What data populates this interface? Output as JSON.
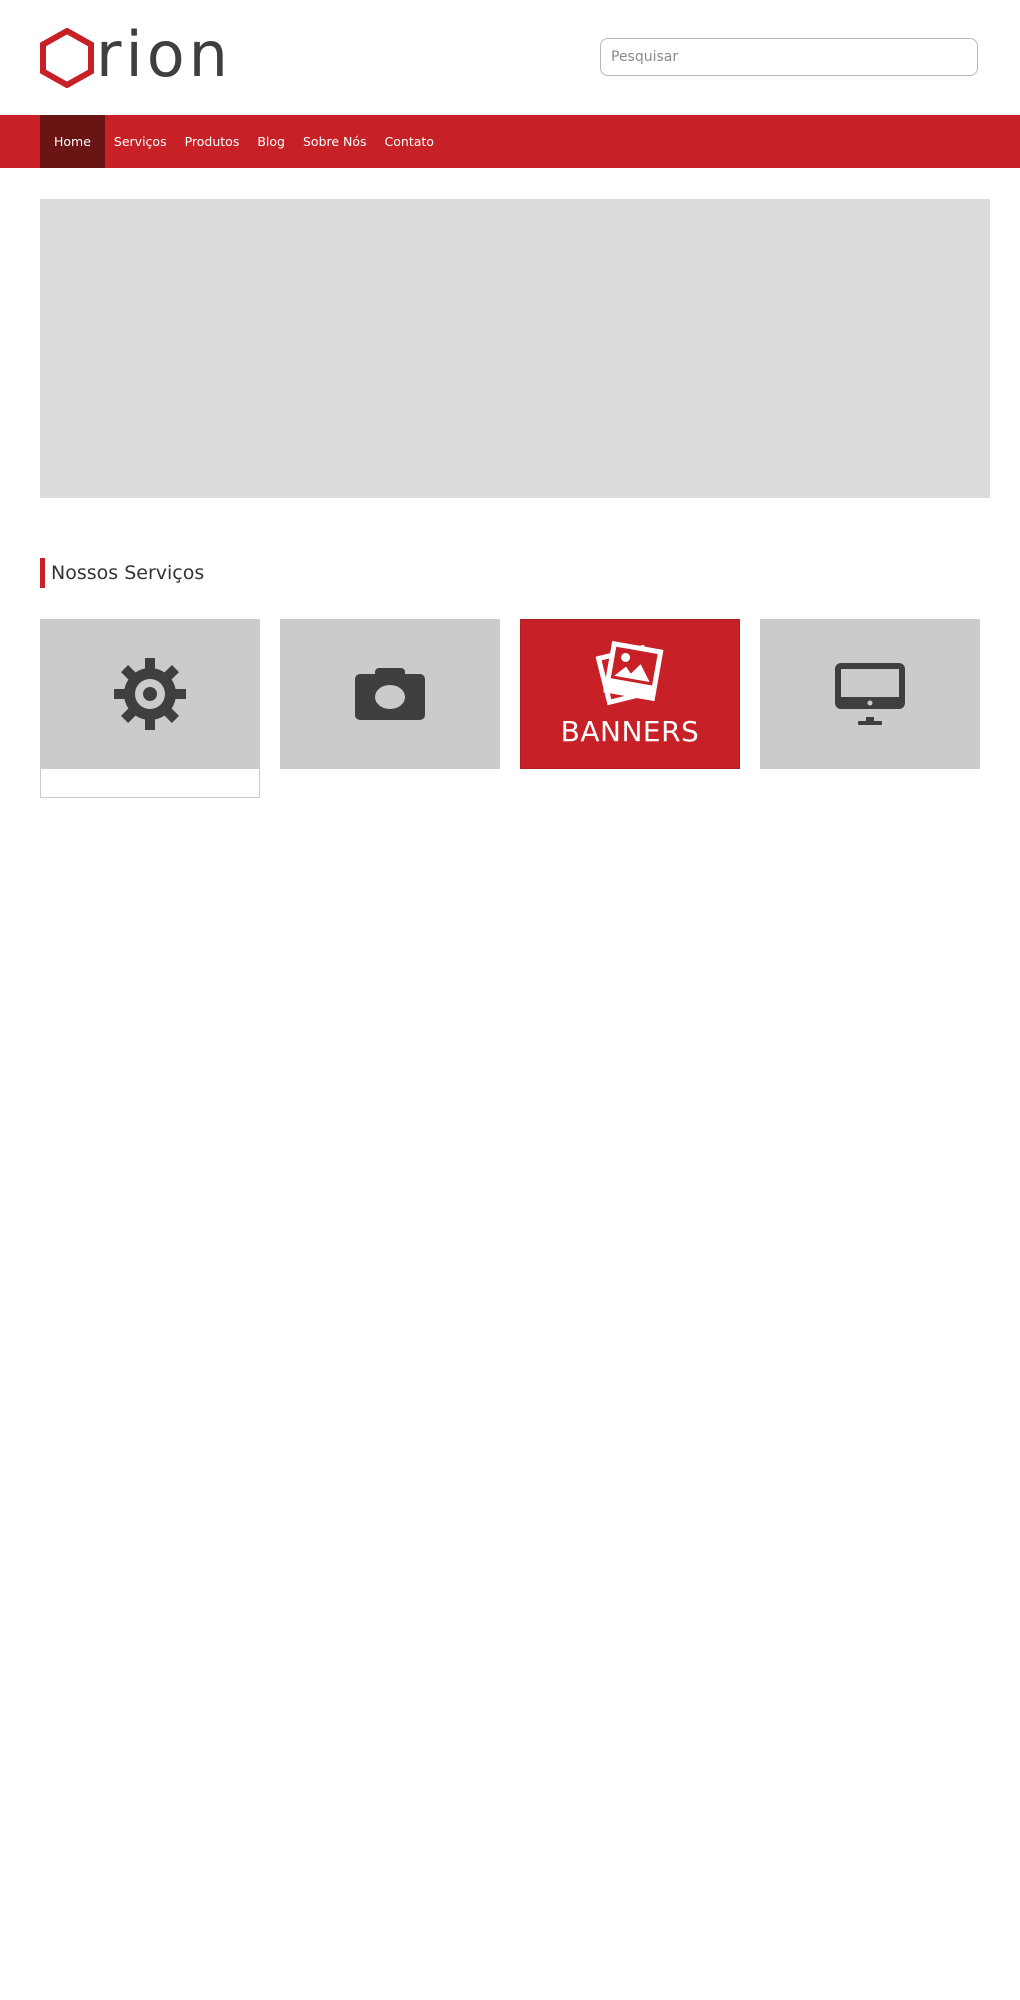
{
  "header": {
    "logo_text": "rion",
    "search_placeholder": "Pesquisar"
  },
  "nav": {
    "items": [
      {
        "label": "Home",
        "active": true
      },
      {
        "label": "Serviços"
      },
      {
        "label": "Produtos"
      },
      {
        "label": "Blog"
      },
      {
        "label": "Sobre Nós"
      },
      {
        "label": "Contato"
      }
    ]
  },
  "services": {
    "title": "Nossos Serviços",
    "cards": [
      {
        "icon": "gear-icon"
      },
      {
        "icon": "camera-icon"
      },
      {
        "icon": "images-icon",
        "label": "BANNERS"
      },
      {
        "icon": "monitor-icon"
      }
    ]
  },
  "colors": {
    "accent": "#c72026",
    "nav_active": "#6a1414",
    "card_bg": "#cbcbcb",
    "banner_bg": "#dcdcdc",
    "icon": "#3f3f3f"
  }
}
